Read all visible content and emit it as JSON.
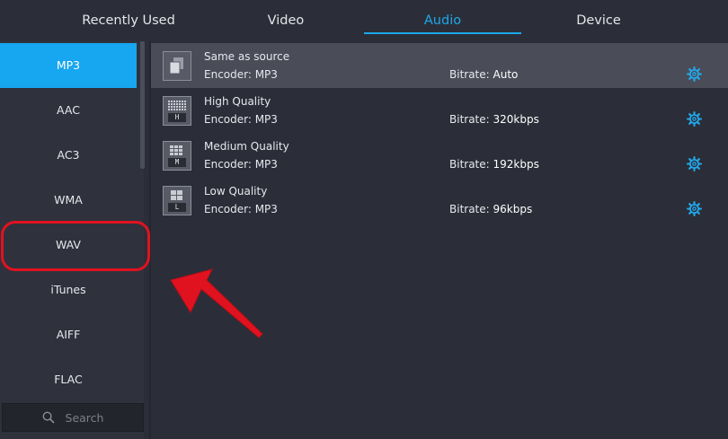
{
  "tabs": [
    {
      "label": "Recently Used"
    },
    {
      "label": "Video"
    },
    {
      "label": "Audio",
      "active": true
    },
    {
      "label": "Device"
    }
  ],
  "sidebar": {
    "formats": [
      {
        "label": "MP3",
        "active": true
      },
      {
        "label": "AAC"
      },
      {
        "label": "AC3"
      },
      {
        "label": "WMA"
      },
      {
        "label": "WAV"
      },
      {
        "label": "iTunes"
      },
      {
        "label": "AIFF"
      },
      {
        "label": "FLAC"
      }
    ],
    "search_placeholder": "Search"
  },
  "presets": [
    {
      "name": "Same as source",
      "encoder": "Encoder: MP3",
      "bitrate_label": "Bitrate:",
      "bitrate_value": "Auto",
      "icon": "copy-icon",
      "letter": "",
      "selected": true
    },
    {
      "name": "High Quality",
      "encoder": "Encoder: MP3",
      "bitrate_label": "Bitrate:",
      "bitrate_value": "320kbps",
      "icon": "quality-high-icon",
      "letter": "H"
    },
    {
      "name": "Medium Quality",
      "encoder": "Encoder: MP3",
      "bitrate_label": "Bitrate:",
      "bitrate_value": "192kbps",
      "icon": "quality-medium-icon",
      "letter": "M"
    },
    {
      "name": "Low Quality",
      "encoder": "Encoder: MP3",
      "bitrate_label": "Bitrate:",
      "bitrate_value": "96kbps",
      "icon": "quality-low-icon",
      "letter": "L"
    }
  ],
  "colors": {
    "accent": "#1ea7ea",
    "active_item_bg": "#17a6f0",
    "selected_row_bg": "#4a4c58",
    "annotation_red": "#e1121f"
  }
}
